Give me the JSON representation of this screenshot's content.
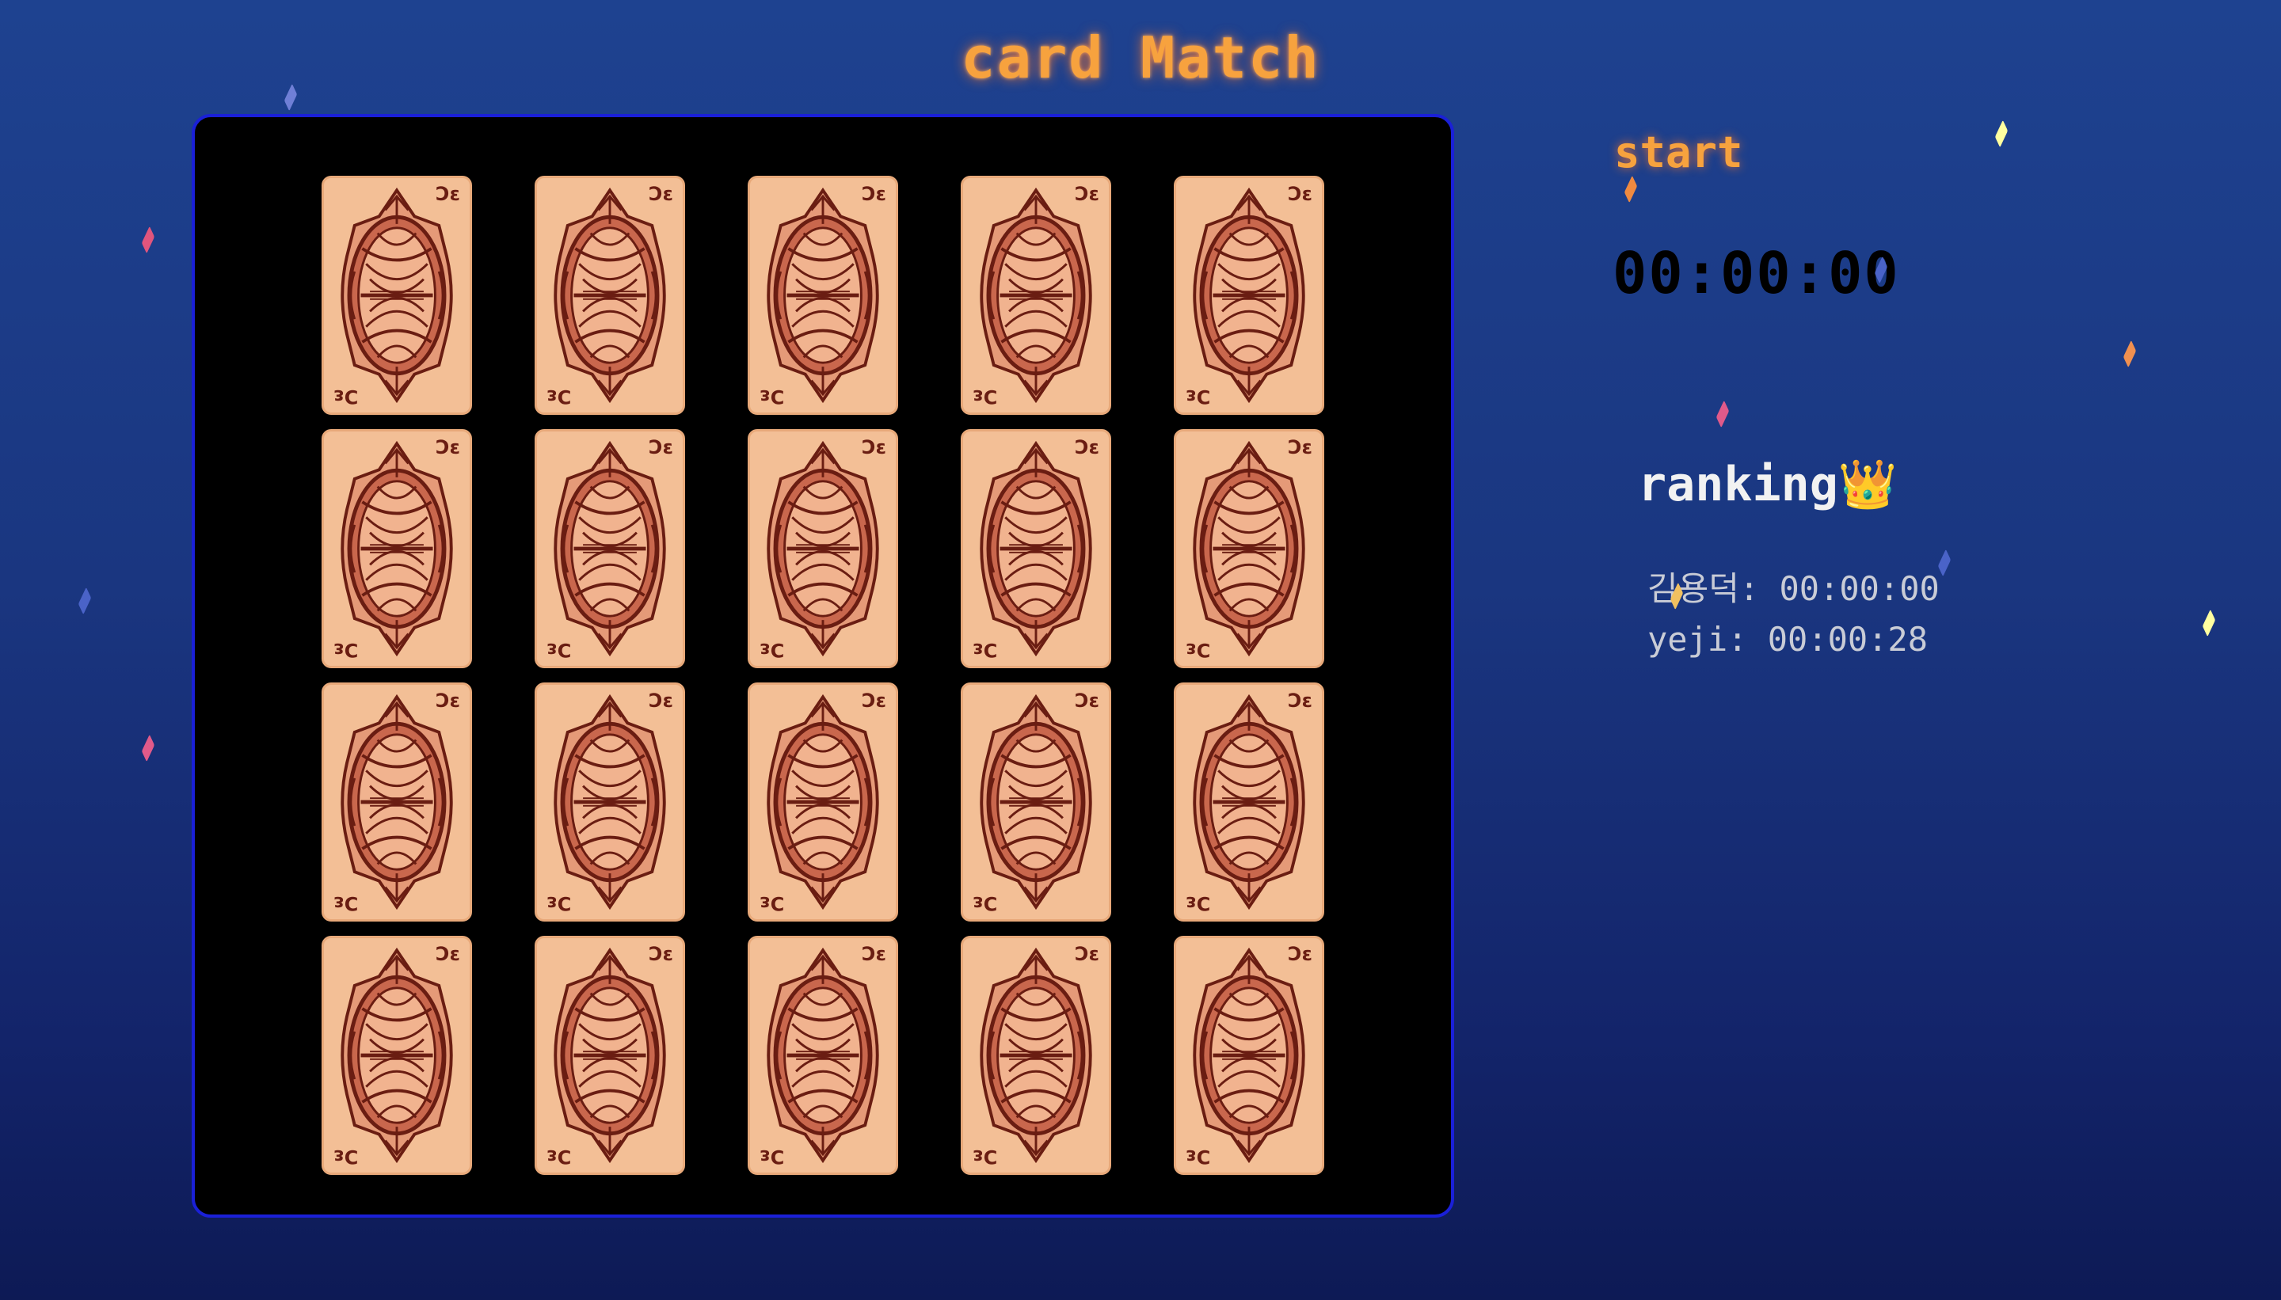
{
  "title": "card Match",
  "board": {
    "cards": [
      {
        "corner_top": "Ɔɛ",
        "corner_bottom": "Ɔɛ"
      },
      {
        "corner_top": "Ɔɛ",
        "corner_bottom": "Ɔɛ"
      },
      {
        "corner_top": "Ɔɛ",
        "corner_bottom": "Ɔɛ"
      },
      {
        "corner_top": "Ɔɛ",
        "corner_bottom": "Ɔɛ"
      },
      {
        "corner_top": "Ɔɛ",
        "corner_bottom": "Ɔɛ"
      },
      {
        "corner_top": "Ɔɛ",
        "corner_bottom": "Ɔɛ"
      },
      {
        "corner_top": "Ɔɛ",
        "corner_bottom": "Ɔɛ"
      },
      {
        "corner_top": "Ɔɛ",
        "corner_bottom": "Ɔɛ"
      },
      {
        "corner_top": "Ɔɛ",
        "corner_bottom": "Ɔɛ"
      },
      {
        "corner_top": "Ɔɛ",
        "corner_bottom": "Ɔɛ"
      },
      {
        "corner_top": "Ɔɛ",
        "corner_bottom": "Ɔɛ"
      },
      {
        "corner_top": "Ɔɛ",
        "corner_bottom": "Ɔɛ"
      },
      {
        "corner_top": "Ɔɛ",
        "corner_bottom": "Ɔɛ"
      },
      {
        "corner_top": "Ɔɛ",
        "corner_bottom": "Ɔɛ"
      },
      {
        "corner_top": "Ɔɛ",
        "corner_bottom": "Ɔɛ"
      },
      {
        "corner_top": "Ɔɛ",
        "corner_bottom": "Ɔɛ"
      },
      {
        "corner_top": "Ɔɛ",
        "corner_bottom": "Ɔɛ"
      },
      {
        "corner_top": "Ɔɛ",
        "corner_bottom": "Ɔɛ"
      },
      {
        "corner_top": "Ɔɛ",
        "corner_bottom": "Ɔɛ"
      },
      {
        "corner_top": "Ɔɛ",
        "corner_bottom": "Ɔɛ"
      }
    ]
  },
  "controls": {
    "start_label": "start",
    "timer": "00:00:00"
  },
  "ranking": {
    "title": "ranking👑",
    "entries": [
      "김용덕: 00:00:00",
      "yeji: 00:00:28"
    ]
  },
  "colors": {
    "accent": "#f7a23e",
    "board_border": "#1a20d8",
    "card_face": "#f3bf96",
    "card_ink": "#6a1d12",
    "background_top": "#1e4290",
    "background_bottom": "#0d1a55"
  },
  "icons": {
    "ranking": "crown-icon",
    "card_back": "ornate-card-back-icon"
  }
}
